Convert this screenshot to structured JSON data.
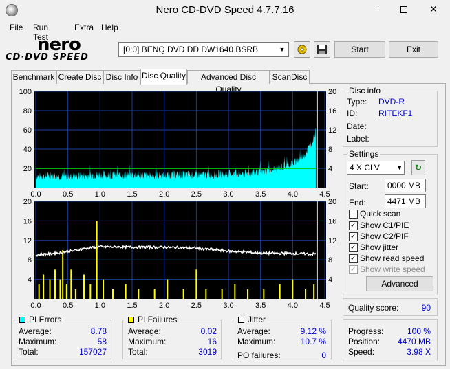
{
  "window": {
    "title": "Nero CD-DVD Speed 4.7.7.16",
    "close_glyph": "✕"
  },
  "menu": [
    "File",
    "Run Test",
    "Extra",
    "Help"
  ],
  "logo": {
    "brand": "nero",
    "sub": "CD·DVD SPEED"
  },
  "drive": {
    "selected": "[0:0]   BENQ DVD DD DW1640 BSRB",
    "options": [
      "[0:0]   BENQ DVD DD DW1640 BSRB"
    ]
  },
  "toolbar": {
    "start_label": "Start",
    "exit_label": "Exit"
  },
  "tabs": [
    {
      "label": "Benchmark",
      "active": false
    },
    {
      "label": "Create Disc",
      "active": false
    },
    {
      "label": "Disc Info",
      "active": false
    },
    {
      "label": "Disc Quality",
      "active": true
    },
    {
      "label": "Advanced Disc Quality",
      "active": false
    },
    {
      "label": "ScanDisc",
      "active": false
    }
  ],
  "chart_data": [
    {
      "type": "area",
      "name": "PI Errors / read speed",
      "x_ticks": [
        "0.0",
        "0.5",
        "1.0",
        "1.5",
        "2.0",
        "2.5",
        "3.0",
        "3.5",
        "4.0",
        "4.5"
      ],
      "xlim": [
        0,
        4.5
      ],
      "y_left_ticks": [
        "100",
        "80",
        "60",
        "40",
        "20"
      ],
      "ylim_left": [
        0,
        100
      ],
      "y_right_ticks": [
        "20",
        "16",
        "12",
        "8",
        "4"
      ],
      "ylim_right": [
        0,
        20
      ],
      "grid": true,
      "series": [
        {
          "name": "PI Errors",
          "color": "#00ffff",
          "x": [
            0.0,
            0.25,
            0.5,
            0.75,
            1.0,
            1.25,
            1.5,
            1.75,
            2.0,
            2.25,
            2.5,
            2.75,
            3.0,
            3.25,
            3.5,
            3.75,
            4.0,
            4.1,
            4.2,
            4.3,
            4.36
          ],
          "y": [
            12,
            13,
            12,
            13,
            14,
            13,
            14,
            13,
            13,
            14,
            14,
            14,
            15,
            15,
            17,
            20,
            26,
            30,
            36,
            48,
            58
          ]
        },
        {
          "name": "Read Speed",
          "color": "#00cc00",
          "x": [
            0.0,
            4.36
          ],
          "y": [
            3.98,
            3.98
          ]
        }
      ]
    },
    {
      "type": "bar",
      "name": "PI Failures / jitter",
      "x_ticks": [
        "0.0",
        "0.5",
        "1.0",
        "1.5",
        "2.0",
        "2.5",
        "3.0",
        "3.5",
        "4.0",
        "4.5"
      ],
      "xlim": [
        0,
        4.5
      ],
      "y_left_ticks": [
        "20",
        "16",
        "12",
        "8",
        "4"
      ],
      "ylim_left": [
        0,
        20
      ],
      "y_right_ticks": [
        "20",
        "16",
        "12",
        "8",
        "4"
      ],
      "ylim_right": [
        0,
        20
      ],
      "grid": true,
      "series": [
        {
          "name": "PI Failures",
          "color": "#ffff00",
          "x": [
            0.05,
            0.12,
            0.22,
            0.3,
            0.38,
            0.42,
            0.48,
            0.55,
            0.62,
            0.75,
            0.85,
            0.95,
            1.05,
            1.2,
            1.4,
            1.6,
            1.85,
            2.05,
            2.3,
            2.5,
            2.65,
            2.9,
            3.1,
            3.3,
            3.55,
            3.8,
            4.0,
            4.2,
            4.33
          ],
          "y": [
            3,
            5,
            4,
            6,
            4,
            10,
            3,
            6,
            2,
            5,
            3,
            16,
            4,
            2,
            3,
            2,
            2,
            4,
            2,
            6,
            2,
            2,
            3,
            2,
            2,
            3,
            4,
            2,
            3
          ]
        },
        {
          "name": "Jitter",
          "color": "#ffffff",
          "x": [
            0.0,
            0.2,
            0.4,
            0.6,
            0.8,
            1.0,
            1.5,
            2.0,
            2.5,
            3.0,
            3.5,
            4.0,
            4.36
          ],
          "y": [
            9.0,
            9.2,
            9.5,
            9.9,
            10.4,
            10.7,
            10.6,
            10.6,
            10.4,
            9.8,
            9.4,
            9.3,
            9.2
          ]
        }
      ]
    }
  ],
  "disc_info": {
    "title": "Disc info",
    "type_label": "Type:",
    "type_value": "DVD-R",
    "id_label": "ID:",
    "id_value": "RITEKF1",
    "date_label": "Date:",
    "label_label": "Label:"
  },
  "settings": {
    "title": "Settings",
    "speed": "4 X CLV",
    "start_label": "Start:",
    "start_value": "0000 MB",
    "end_label": "End:",
    "end_value": "4471 MB",
    "quick_scan": {
      "label": "Quick scan",
      "checked": false
    },
    "show_c1": {
      "label": "Show C1/PIE",
      "checked": true
    },
    "show_c2": {
      "label": "Show C2/PIF",
      "checked": true
    },
    "show_jitter": {
      "label": "Show jitter",
      "checked": true
    },
    "show_read": {
      "label": "Show read speed",
      "checked": true
    },
    "show_write": {
      "label": "Show write speed",
      "checked": true,
      "disabled": true
    },
    "advanced_label": "Advanced"
  },
  "quality": {
    "label": "Quality score:",
    "value": "90"
  },
  "progress": {
    "progress_label": "Progress:",
    "progress_value": "100 %",
    "position_label": "Position:",
    "position_value": "4470 MB",
    "speed_label": "Speed:",
    "speed_value": "3.98 X"
  },
  "pi_errors": {
    "title": "PI Errors",
    "color": "#00ffff",
    "avg_label": "Average:",
    "avg": "8.78",
    "max_label": "Maximum:",
    "max": "58",
    "total_label": "Total:",
    "total": "157027"
  },
  "pi_failures": {
    "title": "PI Failures",
    "color": "#ffff00",
    "avg_label": "Average:",
    "avg": "0.02",
    "max_label": "Maximum:",
    "max": "16",
    "total_label": "Total:",
    "total": "3019"
  },
  "jitter": {
    "title": "Jitter",
    "color": "#ffffff",
    "avg_label": "Average:",
    "avg": "9.12 %",
    "max_label": "Maximum:",
    "max": "10.7 %",
    "po_label": "PO failures:",
    "po": "0"
  },
  "colors": {
    "chart_bg": "#000000",
    "grid": "#1a3fa0",
    "tick": "#000000"
  }
}
